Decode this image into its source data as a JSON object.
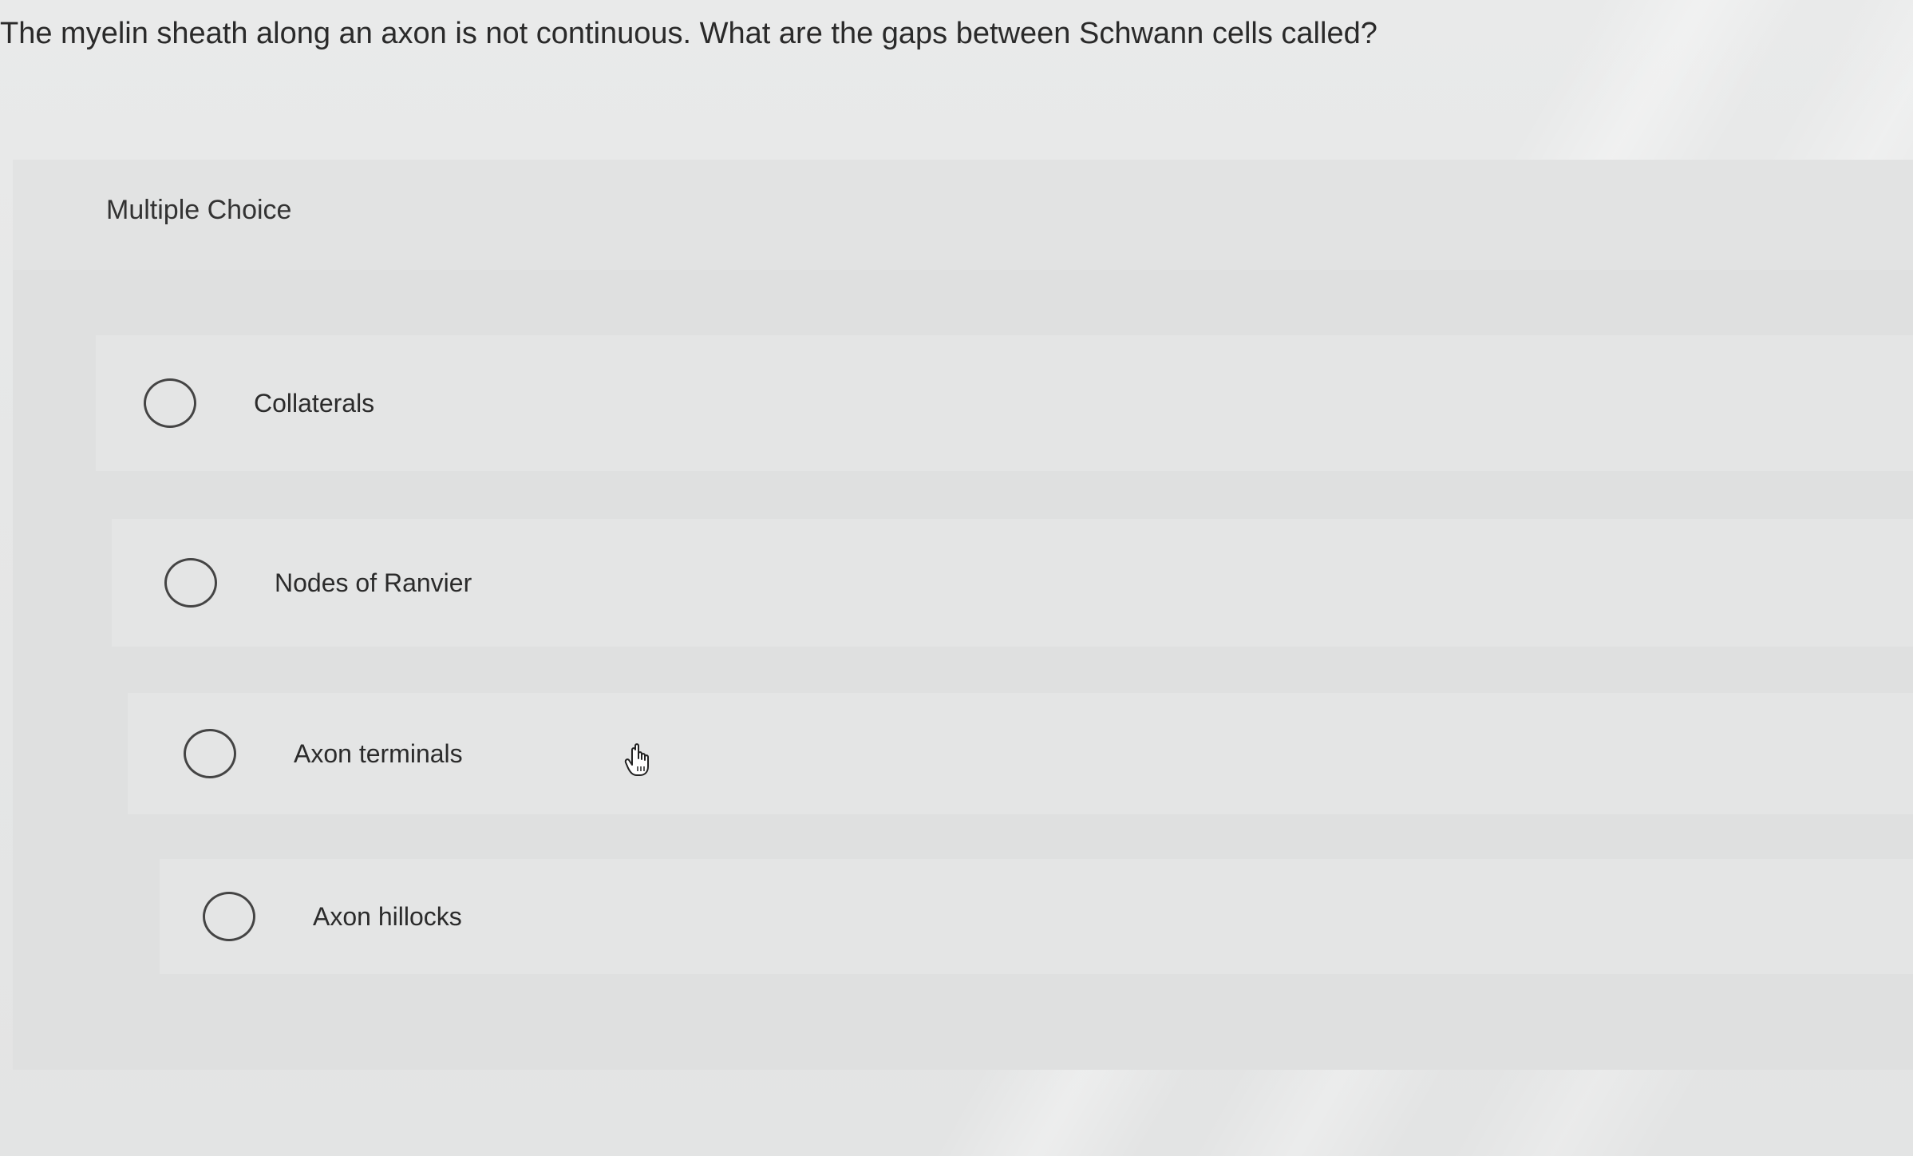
{
  "question": {
    "text": "The myelin sheath along an axon is not continuous. What are the gaps between Schwann cells called?"
  },
  "section": {
    "label": "Multiple Choice"
  },
  "options": [
    {
      "label": "Collaterals",
      "selected": false
    },
    {
      "label": "Nodes of Ranvier",
      "selected": false
    },
    {
      "label": "Axon terminals",
      "selected": false
    },
    {
      "label": "Axon hillocks",
      "selected": false
    }
  ],
  "cursor": {
    "icon": "hand-pointer-icon"
  }
}
